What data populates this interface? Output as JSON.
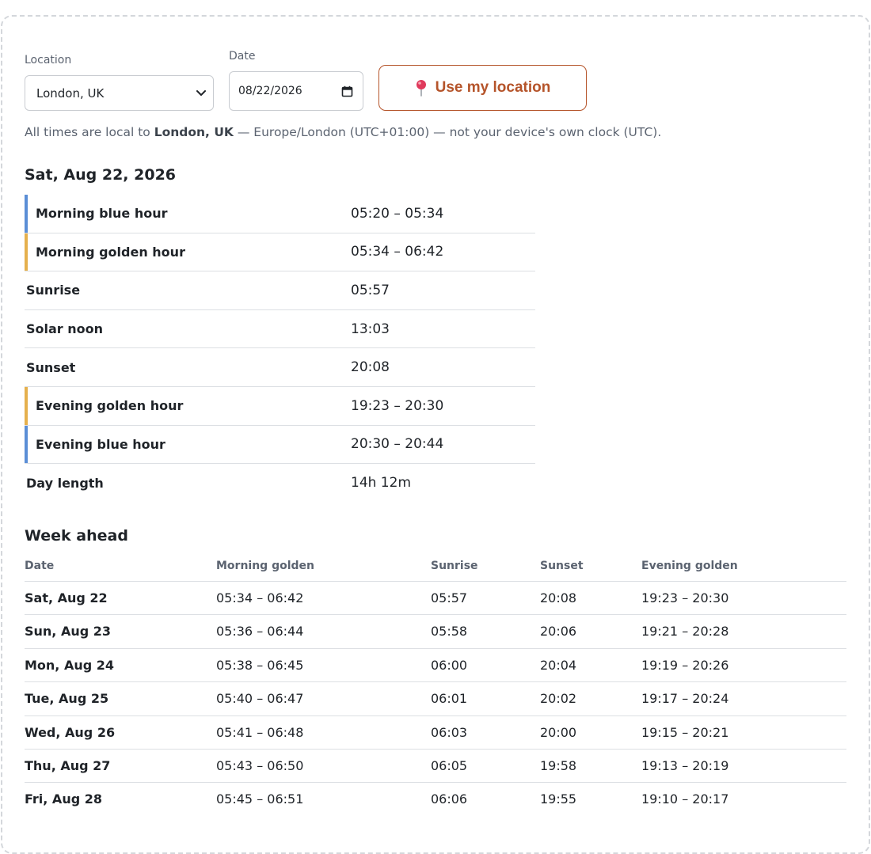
{
  "controls": {
    "location_label": "Location",
    "location_value": "London, UK",
    "date_label": "Date",
    "date_value": "08/22/2026",
    "use_location_label": "Use my location"
  },
  "note": {
    "prefix": "All times are local to ",
    "place": "London, UK",
    "suffix": " — Europe/London (UTC+01:00) — not your device's own clock (UTC)."
  },
  "today": {
    "title": "Sat, Aug 22, 2026",
    "rows": [
      {
        "label": "Morning blue hour",
        "value": "05:20 – 05:34"
      },
      {
        "label": "Morning golden hour",
        "value": "05:34 – 06:42"
      },
      {
        "label": "Sunrise",
        "value": "05:57"
      },
      {
        "label": "Solar noon",
        "value": "13:03"
      },
      {
        "label": "Sunset",
        "value": "20:08"
      },
      {
        "label": "Evening golden hour",
        "value": "19:23 – 20:30"
      },
      {
        "label": "Evening blue hour",
        "value": "20:30 – 20:44"
      },
      {
        "label": "Day length",
        "value": "14h 12m"
      }
    ]
  },
  "colors": {
    "blue_hour": "#5b8ed6",
    "golden_hour": "#e5b04d",
    "accent": "#b5542a"
  },
  "week": {
    "title": "Week ahead",
    "headers": [
      "Date",
      "Morning golden",
      "Sunrise",
      "Sunset",
      "Evening golden"
    ],
    "rows": [
      [
        "Sat, Aug 22",
        "05:34 – 06:42",
        "05:57",
        "20:08",
        "19:23 – 20:30"
      ],
      [
        "Sun, Aug 23",
        "05:36 – 06:44",
        "05:58",
        "20:06",
        "19:21 – 20:28"
      ],
      [
        "Mon, Aug 24",
        "05:38 – 06:45",
        "06:00",
        "20:04",
        "19:19 – 20:26"
      ],
      [
        "Tue, Aug 25",
        "05:40 – 06:47",
        "06:01",
        "20:02",
        "19:17 – 20:24"
      ],
      [
        "Wed, Aug 26",
        "05:41 – 06:48",
        "06:03",
        "20:00",
        "19:15 – 20:21"
      ],
      [
        "Thu, Aug 27",
        "05:43 – 06:50",
        "06:05",
        "19:58",
        "19:13 – 20:19"
      ],
      [
        "Fri, Aug 28",
        "05:45 – 06:51",
        "06:06",
        "19:55",
        "19:10 – 20:17"
      ]
    ]
  }
}
